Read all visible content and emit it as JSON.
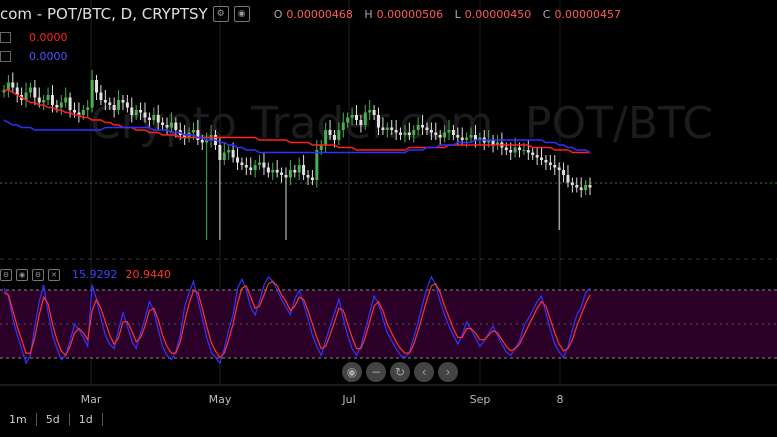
{
  "header": {
    "title": "com - POT/BTC, D, CRYPTSY",
    "o_label": "O",
    "o_value": "0.00000468",
    "h_label": "H",
    "h_value": "0.00000506",
    "l_label": "L",
    "l_value": "0.00000450",
    "c_label": "C",
    "c_value": "0.00000457"
  },
  "watermark": "POT/BTC",
  "ma_legend": [
    {
      "value": "0.0000",
      "color": "#ff2020"
    },
    {
      "value": "0.0000",
      "color": "#3030ff"
    }
  ],
  "oscillator": {
    "k_value": "15.9292",
    "d_value": "20.9440",
    "k_color": "#3333ff",
    "d_color": "#ff3333"
  },
  "periods": [
    "1m",
    "5d",
    "1d"
  ],
  "nav_icons": [
    "zoom-out-icon",
    "minus-icon",
    "reset-icon",
    "scroll-left-icon",
    "scroll-right-icon"
  ],
  "chart_data": [
    {
      "type": "candlestick",
      "x_labels": [
        "Mar",
        "May",
        "Jul",
        "Sep",
        "8"
      ],
      "close": [
        60,
        63,
        61,
        58,
        56,
        59,
        61,
        57,
        55,
        56,
        58,
        54,
        53,
        55,
        57,
        52,
        51,
        50,
        52,
        53,
        64,
        59,
        56,
        55,
        54,
        52,
        56,
        55,
        53,
        50,
        52,
        51,
        49,
        48,
        50,
        47,
        46,
        45,
        47,
        44,
        42,
        41,
        43,
        44,
        40,
        39,
        40,
        42,
        38,
        32,
        35,
        36,
        33,
        31,
        30,
        29,
        28,
        30,
        31,
        29,
        27,
        28,
        27,
        26,
        25,
        28,
        27,
        30,
        26,
        25,
        24,
        36,
        38,
        44,
        42,
        40,
        44,
        47,
        49,
        50,
        48,
        46,
        51,
        52,
        50,
        45,
        44,
        45,
        44,
        43,
        42,
        43,
        42,
        44,
        46,
        45,
        44,
        43,
        42,
        41,
        43,
        44,
        42,
        41,
        40,
        41,
        42,
        40,
        41,
        39,
        40,
        38,
        39,
        37,
        36,
        35,
        37,
        36,
        36,
        35,
        34,
        33,
        32,
        31,
        30,
        29,
        28,
        26,
        23,
        22,
        21,
        20,
        22,
        21
      ],
      "ma_red": [
        60,
        60,
        59,
        58,
        57,
        56,
        55,
        55,
        54,
        54,
        53,
        53,
        52,
        52,
        51,
        51,
        50,
        50,
        49,
        49,
        48,
        48,
        48,
        47,
        47,
        46,
        46,
        45,
        45,
        45,
        44,
        44,
        44,
        43,
        43,
        43,
        42,
        42,
        42,
        42,
        41,
        41,
        41,
        41,
        41,
        41,
        41,
        41,
        41,
        41,
        41,
        41,
        41,
        41,
        41,
        41,
        41,
        41,
        40,
        40,
        40,
        40,
        40,
        40,
        40,
        39,
        39,
        39,
        39,
        39,
        38,
        38,
        38,
        38,
        38,
        38,
        37,
        37,
        37,
        37,
        36,
        36,
        36,
        36,
        36,
        36,
        36,
        36,
        36,
        36,
        36,
        36,
        37,
        37,
        37,
        37,
        37,
        37,
        37,
        37,
        37,
        38,
        38,
        38,
        38,
        38,
        38,
        38,
        38,
        38,
        38,
        38,
        38,
        38,
        38,
        38,
        38,
        38,
        38,
        38,
        37,
        37,
        37,
        37,
        37,
        36,
        36,
        36,
        36,
        35,
        35,
        35,
        35,
        35
      ],
      "ma_blue": [
        48,
        47,
        46,
        46,
        45,
        45,
        45,
        44,
        44,
        44,
        44,
        44,
        44,
        44,
        44,
        44,
        44,
        44,
        44,
        44,
        44,
        44,
        44,
        45,
        45,
        45,
        45,
        45,
        45,
        45,
        45,
        45,
        45,
        45,
        44,
        44,
        44,
        44,
        43,
        43,
        43,
        42,
        42,
        42,
        41,
        41,
        40,
        40,
        40,
        39,
        39,
        38,
        38,
        37,
        37,
        36,
        36,
        36,
        35,
        35,
        35,
        35,
        35,
        35,
        35,
        35,
        35,
        35,
        35,
        35,
        35,
        35,
        35,
        35,
        35,
        35,
        35,
        35,
        35,
        35,
        35,
        35,
        35,
        35,
        35,
        35,
        35,
        35,
        35,
        35,
        35,
        35,
        36,
        36,
        36,
        36,
        37,
        37,
        37,
        38,
        38,
        38,
        38,
        39,
        39,
        39,
        39,
        40,
        40,
        40,
        40,
        40,
        40,
        40,
        40,
        40,
        40,
        40,
        40,
        40,
        40,
        40,
        40,
        39,
        39,
        39,
        38,
        38,
        37,
        37,
        36,
        36,
        36,
        35
      ]
    },
    {
      "type": "line",
      "ylim": [
        0,
        100
      ],
      "series": [
        {
          "values": [
            82,
            75,
            55,
            40,
            28,
            15,
            22,
            48,
            70,
            85,
            60,
            40,
            28,
            18,
            22,
            35,
            50,
            45,
            38,
            30,
            85,
            72,
            55,
            40,
            32,
            28,
            45,
            60,
            48,
            35,
            28,
            42,
            55,
            70,
            62,
            45,
            30,
            22,
            18,
            25,
            40,
            65,
            78,
            88,
            72,
            55,
            38,
            25,
            20,
            15,
            28,
            45,
            58,
            82,
            90,
            80,
            65,
            58,
            70,
            85,
            92,
            88,
            80,
            72,
            65,
            58,
            72,
            80,
            68,
            55,
            40,
            30,
            22,
            35,
            48,
            60,
            72,
            55,
            40,
            28,
            22,
            30,
            45,
            60,
            75,
            68,
            55,
            42,
            35,
            28,
            22,
            20,
            25,
            38,
            52,
            68,
            82,
            92,
            85,
            70,
            58,
            48,
            40,
            32,
            40,
            52,
            45,
            38,
            30,
            35,
            42,
            48,
            40,
            32,
            25,
            22,
            28,
            35,
            48,
            55,
            62,
            70,
            75,
            60,
            45,
            32,
            25,
            20,
            30,
            45,
            58,
            65,
            78,
            82
          ]
        },
        {
          "values": [
            78,
            76,
            62,
            48,
            36,
            24,
            24,
            38,
            58,
            74,
            68,
            50,
            36,
            26,
            22,
            30,
            42,
            46,
            42,
            36,
            62,
            72,
            64,
            52,
            40,
            32,
            38,
            52,
            52,
            44,
            34,
            38,
            48,
            62,
            64,
            54,
            40,
            30,
            24,
            24,
            34,
            52,
            68,
            80,
            78,
            64,
            48,
            34,
            26,
            20,
            24,
            36,
            50,
            68,
            82,
            84,
            74,
            64,
            66,
            76,
            86,
            88,
            84,
            76,
            70,
            62,
            66,
            74,
            72,
            62,
            50,
            38,
            28,
            30,
            40,
            52,
            64,
            62,
            50,
            38,
            28,
            28,
            38,
            52,
            66,
            70,
            62,
            50,
            42,
            34,
            28,
            24,
            24,
            32,
            44,
            58,
            72,
            84,
            86,
            78,
            66,
            56,
            46,
            38,
            38,
            46,
            46,
            42,
            36,
            36,
            40,
            44,
            42,
            36,
            30,
            26,
            28,
            32,
            40,
            48,
            56,
            64,
            70,
            66,
            54,
            42,
            32,
            26,
            28,
            36,
            48,
            58,
            68,
            76
          ]
        }
      ]
    }
  ]
}
